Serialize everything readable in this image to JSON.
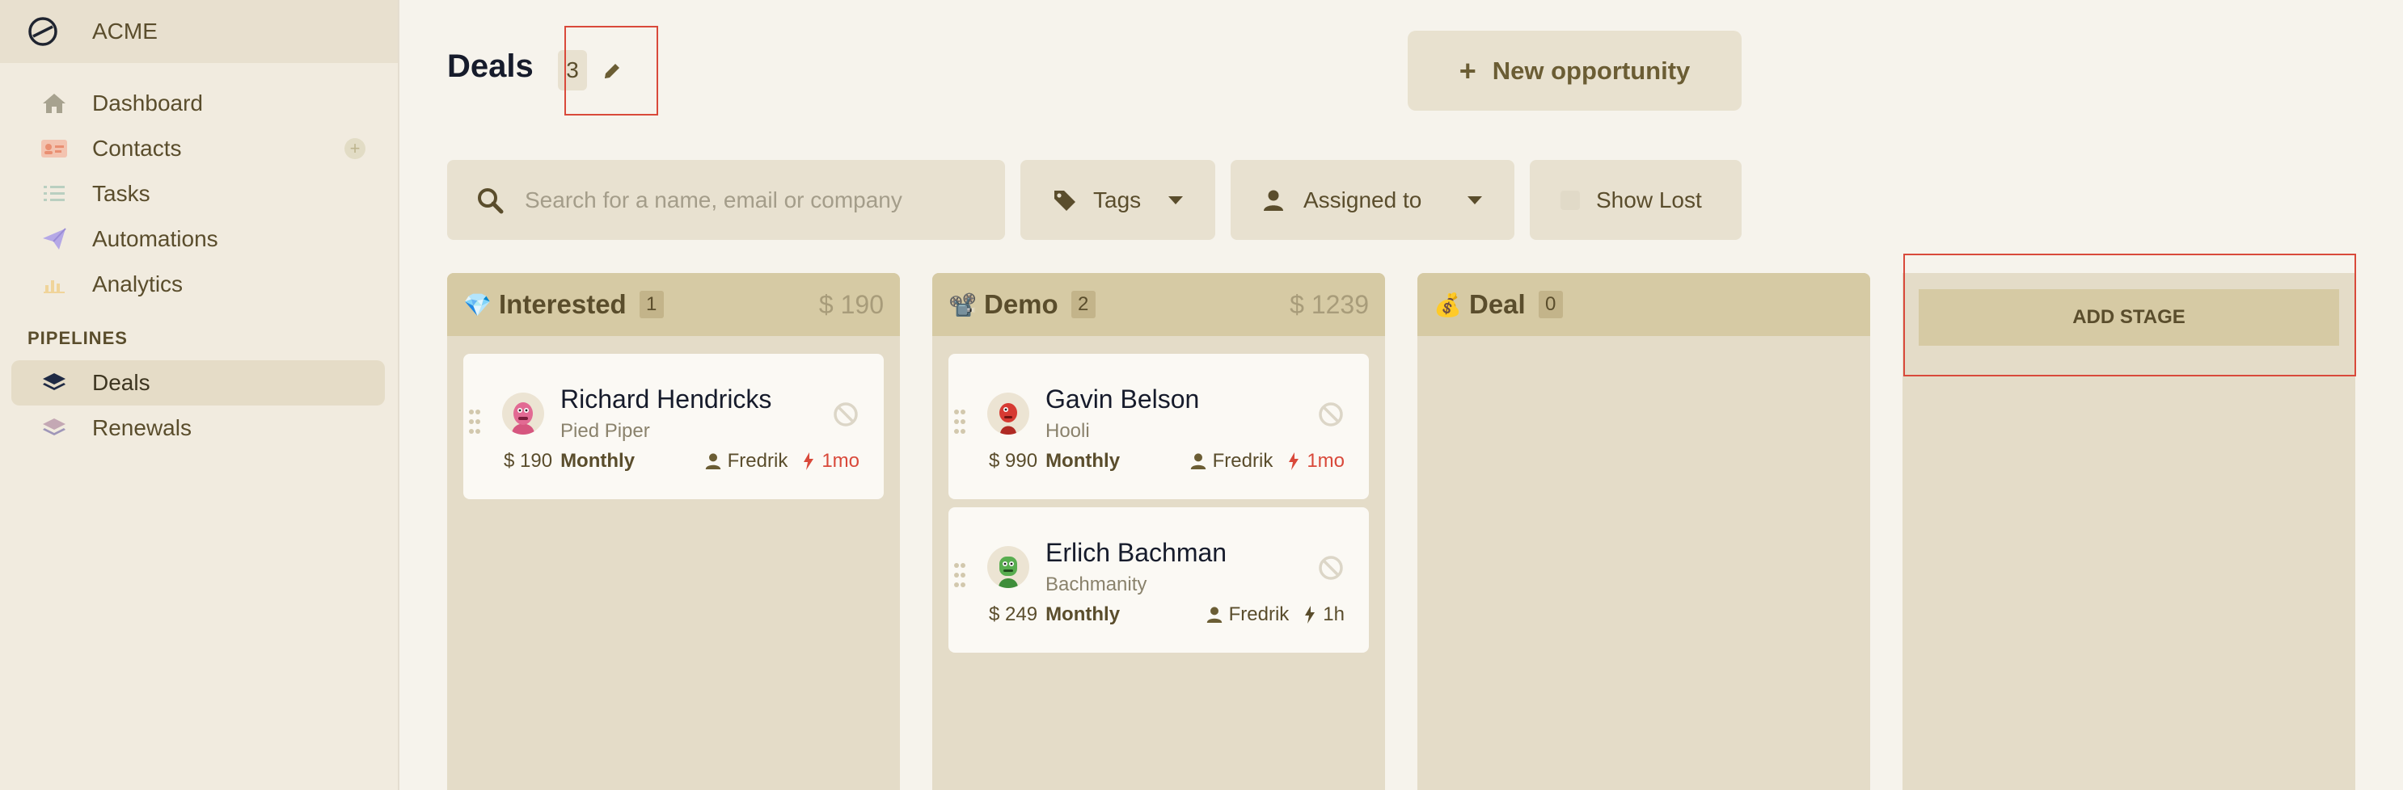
{
  "org": {
    "name": "ACME",
    "logo_icon": "circle-slash-logo"
  },
  "sidebar": {
    "items": [
      {
        "label": "Dashboard",
        "icon": "home-icon"
      },
      {
        "label": "Contacts",
        "icon": "contact-card-icon"
      },
      {
        "label": "Tasks",
        "icon": "checklist-icon"
      },
      {
        "label": "Automations",
        "icon": "paper-plane-icon"
      },
      {
        "label": "Analytics",
        "icon": "bar-chart-icon"
      }
    ],
    "pipelines_title": "PIPELINES",
    "pipelines": [
      {
        "label": "Deals",
        "icon": "layers-icon",
        "active": true
      },
      {
        "label": "Renewals",
        "icon": "layers-icon",
        "active": false
      }
    ]
  },
  "header": {
    "title": "Deals",
    "count": "3",
    "new_button": "New opportunity"
  },
  "filters": {
    "search_placeholder": "Search for a name, email or company",
    "tags_label": "Tags",
    "assigned_label": "Assigned to",
    "show_lost_label": "Show Lost"
  },
  "columns": [
    {
      "emoji": "💎",
      "title": "Interested",
      "count": "1",
      "total": "$ 190",
      "cards": [
        {
          "name": "Richard Hendricks",
          "company": "Pied Piper",
          "amount": "$ 190",
          "period": "Monthly",
          "owner": "Fredrik",
          "age": "1mo",
          "age_overdue": true,
          "avatar": "pink-monster-avatar"
        }
      ]
    },
    {
      "emoji": "📽️",
      "title": "Demo",
      "count": "2",
      "total": "$ 1239",
      "cards": [
        {
          "name": "Gavin Belson",
          "company": "Hooli",
          "amount": "$ 990",
          "period": "Monthly",
          "owner": "Fredrik",
          "age": "1mo",
          "age_overdue": true,
          "avatar": "red-monster-avatar"
        },
        {
          "name": "Erlich Bachman",
          "company": "Bachmanity",
          "amount": "$ 249",
          "period": "Monthly",
          "owner": "Fredrik",
          "age": "1h",
          "age_overdue": false,
          "avatar": "green-monster-avatar"
        }
      ]
    },
    {
      "emoji": "💰",
      "title": "Deal",
      "count": "0",
      "total": "",
      "cards": []
    }
  ],
  "add_stage_label": "ADD STAGE",
  "colors": {
    "background": "#f6f3ec",
    "sidebar": "#f1ebdf",
    "column": "#e4dcc8",
    "column_header": "#d6caa4",
    "accent_text": "#5a4d2c",
    "overdue": "#d9493a",
    "highlight_box": "#d9493a"
  }
}
